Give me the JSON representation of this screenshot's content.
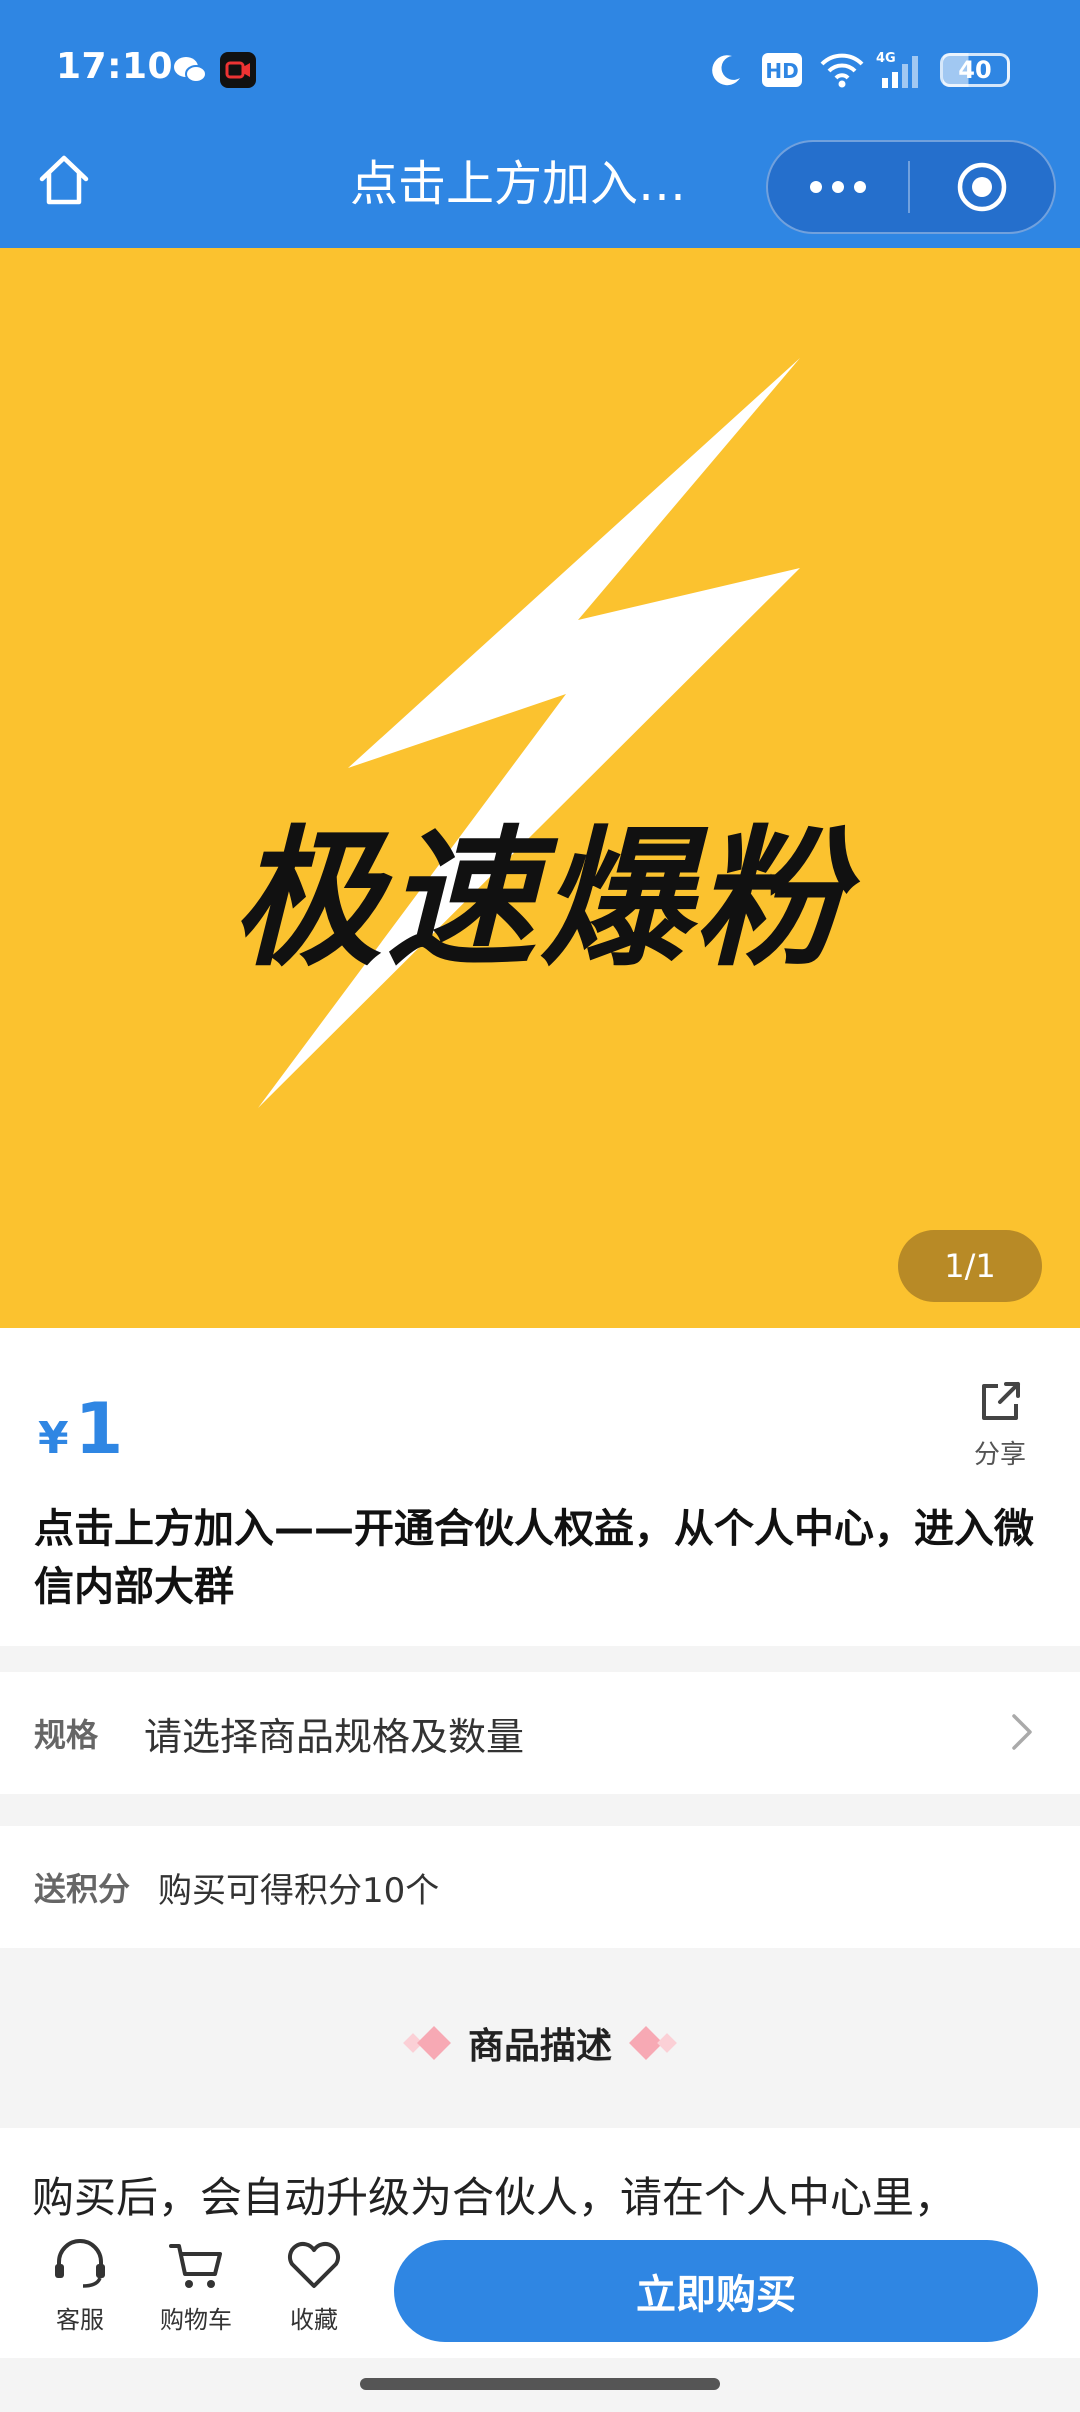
{
  "status_bar": {
    "time": "17:10",
    "network": "4G",
    "battery": "40",
    "hd_label": "HD"
  },
  "nav": {
    "title": "点击上方加入—..."
  },
  "product": {
    "image_text": "极速爆粉",
    "image_counter": "1/1",
    "currency": "¥",
    "price": "1",
    "share_label": "分享",
    "title": "点击上方加入——开通合伙人权益，从个人中心，进入微信内部大群",
    "spec_key": "规格",
    "spec_value": "请选择商品规格及数量",
    "points_key": "送积分",
    "points_value": "购买可得积分10个",
    "desc_heading": "商品描述",
    "desc_first_line": "购买后，会自动升级为合伙人，请在个人中心里，"
  },
  "action_bar": {
    "service_label": "客服",
    "cart_label": "购物车",
    "favorite_label": "收藏",
    "buy_label": "立即购买"
  },
  "colors": {
    "primary": "#2f86e3",
    "hero_bg": "#fbc22f",
    "diamond": "#f7a9b4"
  }
}
